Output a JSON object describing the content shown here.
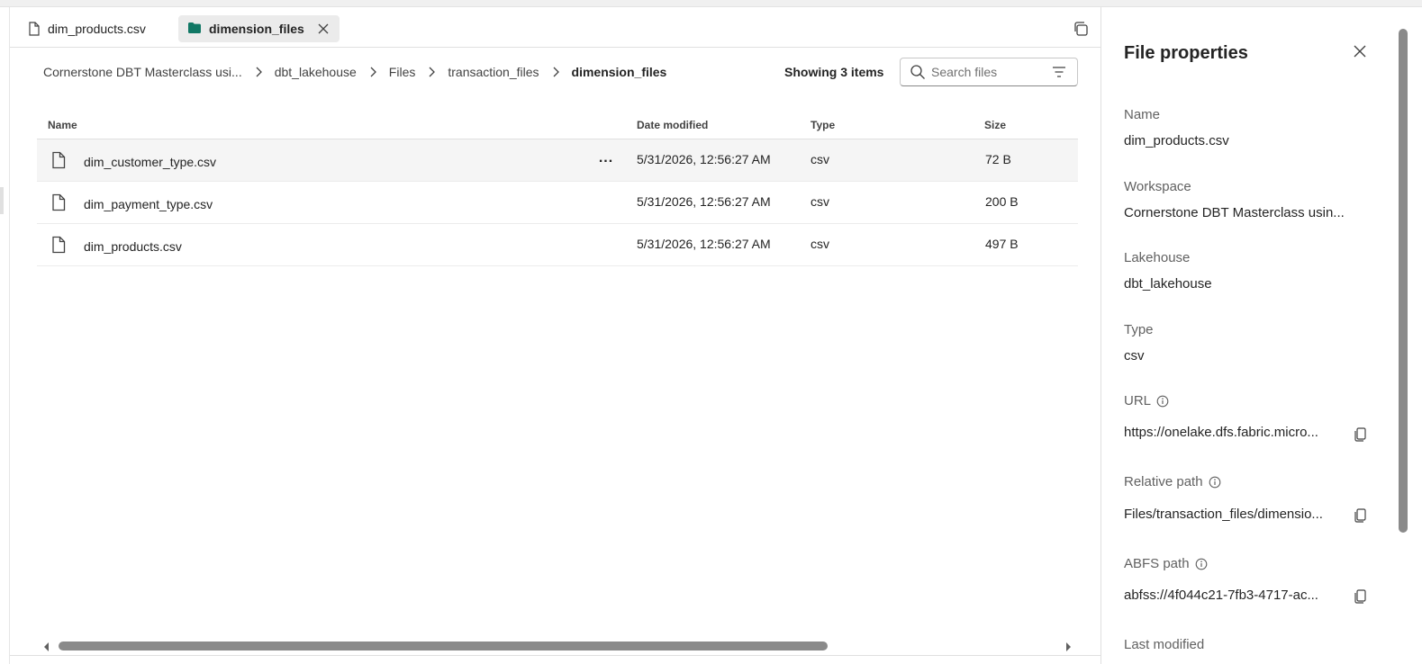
{
  "tabs": [
    {
      "label": "dim_products.csv"
    },
    {
      "label": "dimension_files"
    }
  ],
  "breadcrumb": [
    "Cornerstone DBT Masterclass usi...",
    "dbt_lakehouse",
    "Files",
    "transaction_files",
    "dimension_files"
  ],
  "toolbar": {
    "showing": "Showing 3 items",
    "search_placeholder": "Search files"
  },
  "table": {
    "headers": {
      "name": "Name",
      "date": "Date modified",
      "type": "Type",
      "size": "Size"
    },
    "rows": [
      {
        "name": "dim_customer_type.csv",
        "date": "5/31/2026, 12:56:27 AM",
        "type": "csv",
        "size": "72 B",
        "more": "..."
      },
      {
        "name": "dim_payment_type.csv",
        "date": "5/31/2026, 12:56:27 AM",
        "type": "csv",
        "size": "200 B"
      },
      {
        "name": "dim_products.csv",
        "date": "5/31/2026, 12:56:27 AM",
        "type": "csv",
        "size": "497 B"
      }
    ]
  },
  "panel": {
    "title": "File properties",
    "properties": {
      "name": {
        "label": "Name",
        "value": "dim_products.csv"
      },
      "workspace": {
        "label": "Workspace",
        "value": "Cornerstone DBT Masterclass usin..."
      },
      "lakehouse": {
        "label": "Lakehouse",
        "value": "dbt_lakehouse"
      },
      "type": {
        "label": "Type",
        "value": "csv"
      },
      "url": {
        "label": "URL",
        "value": "https://onelake.dfs.fabric.micro..."
      },
      "relative_path": {
        "label": "Relative path",
        "value": "Files/transaction_files/dimensio..."
      },
      "abfs_path": {
        "label": "ABFS path",
        "value": "abfss://4f044c21-7fb3-4717-ac..."
      },
      "last_modified": {
        "label": "Last modified"
      }
    }
  },
  "colors": {
    "folder_accent": "#117865",
    "scroll_thumb": "#8a8a8a",
    "hover_row": "#f5f5f5"
  }
}
